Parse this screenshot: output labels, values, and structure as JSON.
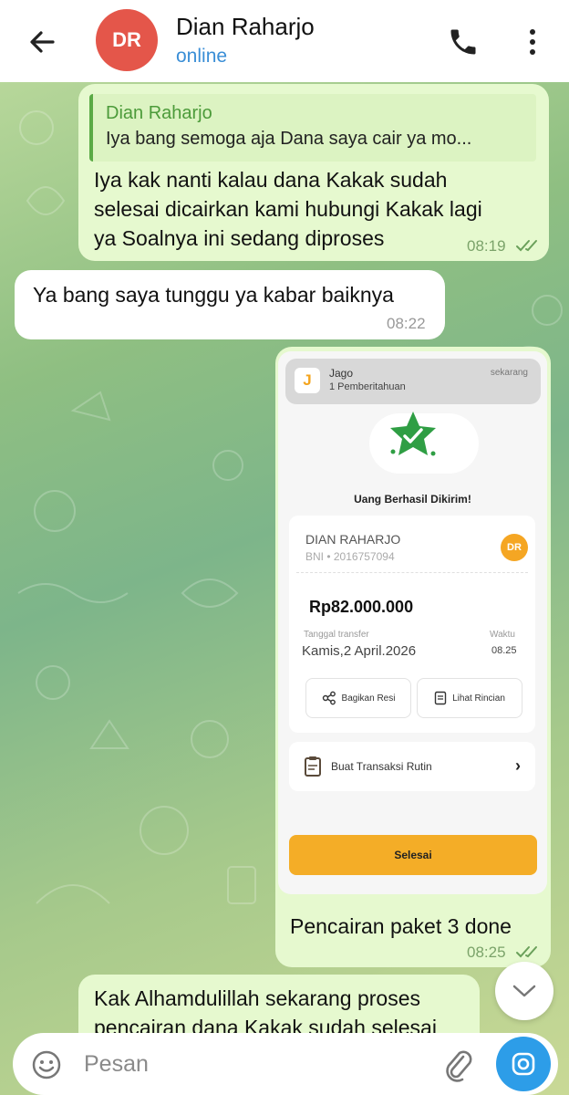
{
  "header": {
    "avatar_initials": "DR",
    "avatar_color": "#e4564a",
    "name": "Dian Raharjo",
    "status": "online",
    "status_color": "#3a8ed6"
  },
  "messages": [
    {
      "type": "outgoing",
      "reply": {
        "name": "Dian Raharjo",
        "text": "Iya bang semoga aja Dana saya cair ya mo..."
      },
      "lines": [
        "Iya kak nanti kalau dana Kakak sudah",
        "selesai dicairkan kami hubungi Kakak lagi",
        "ya Soalnya ini sedang diproses"
      ],
      "time": "08:19"
    },
    {
      "type": "incoming",
      "text": "Ya bang saya tunggu ya kabar baiknya",
      "time": "08:22"
    },
    {
      "type": "outgoing",
      "caption": "Pencairan paket 3 done",
      "time": "08:25"
    },
    {
      "type": "outgoing",
      "lines": [
        "Kak Alhamdulillah sekarang proses",
        "pencairan dana Kakak sudah selesai"
      ]
    }
  ],
  "screenshot": {
    "notification": {
      "app": "Jago",
      "subtitle": "1 Pemberitahuan",
      "time": "sekarang",
      "logo": "J"
    },
    "title": "Uang Berhasil Dikirim!",
    "recipient_name": "DIAN RAHARJO",
    "recipient_account": "BNI • 2016757094",
    "recipient_initials": "DR",
    "amount": "Rp82.000.000",
    "date_label": "Tanggal transfer",
    "date_value": "Kamis,2 April.2026",
    "time_label": "Waktu",
    "time_value": "08.25",
    "share_label": "Bagikan Resi",
    "detail_label": "Lihat Rincian",
    "routine_label": "Buat Transaksi Rutin",
    "done_label": "Selesai",
    "accent": "#f4ad27",
    "success_color": "#2f9e44"
  },
  "input": {
    "placeholder": "Pesan",
    "send_color": "#2d9de8"
  },
  "colors": {
    "outgoing_bubble": "#e6f9cf",
    "incoming_bubble": "#ffffff"
  }
}
